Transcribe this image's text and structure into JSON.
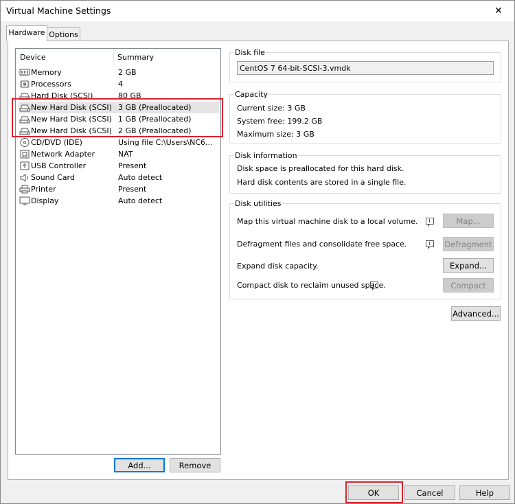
{
  "window": {
    "title": "Virtual Machine Settings",
    "close_glyph": "✕"
  },
  "tabs": [
    {
      "label": "Hardware"
    },
    {
      "label": "Options"
    }
  ],
  "device_list": {
    "headers": {
      "device": "Device",
      "summary": "Summary"
    },
    "items": [
      {
        "icon": "memory-icon",
        "device": "Memory",
        "summary": "2 GB"
      },
      {
        "icon": "processor-icon",
        "device": "Processors",
        "summary": "4"
      },
      {
        "icon": "hard-disk-icon",
        "device": "Hard Disk (SCSI)",
        "summary": "80 GB"
      },
      {
        "icon": "hard-disk-icon",
        "device": "New Hard Disk (SCSI)",
        "summary": "3 GB (Preallocated)"
      },
      {
        "icon": "hard-disk-icon",
        "device": "New Hard Disk (SCSI)",
        "summary": "1 GB (Preallocated)"
      },
      {
        "icon": "hard-disk-icon",
        "device": "New Hard Disk (SCSI)",
        "summary": "2 GB (Preallocated)"
      },
      {
        "icon": "cd-dvd-icon",
        "device": "CD/DVD (IDE)",
        "summary": "Using file C:\\Users\\NC6..."
      },
      {
        "icon": "network-adapter-icon",
        "device": "Network Adapter",
        "summary": "NAT"
      },
      {
        "icon": "usb-icon",
        "device": "USB Controller",
        "summary": "Present"
      },
      {
        "icon": "sound-card-icon",
        "device": "Sound Card",
        "summary": "Auto detect"
      },
      {
        "icon": "printer-icon",
        "device": "Printer",
        "summary": "Present"
      },
      {
        "icon": "display-icon",
        "device": "Display",
        "summary": "Auto detect"
      }
    ],
    "add_label": "Add...",
    "remove_label": "Remove"
  },
  "disk_file": {
    "label": "Disk file",
    "value": "CentOS 7 64-bit-SCSI-3.vmdk"
  },
  "capacity": {
    "label": "Capacity",
    "current_size": "Current size:  3 GB",
    "system_free": "System free:  199.2 GB",
    "maximum_size": "Maximum size:  3 GB"
  },
  "disk_information": {
    "label": "Disk information",
    "line1": "Disk space is preallocated for this hard disk.",
    "line2": "Hard disk contents are stored in a single file."
  },
  "disk_utilities": {
    "label": "Disk utilities",
    "map_text": "Map this virtual machine disk to a local volume.",
    "map_button": "Map...",
    "defrag_text": "Defragment files and consolidate free space.",
    "defrag_button": "Defragment",
    "expand_text": "Expand disk capacity.",
    "expand_button": "Expand...",
    "compact_text": "Compact disk to reclaim unused space.",
    "compact_button": "Compact"
  },
  "advanced_label": "Advanced...",
  "footer": {
    "ok": "OK",
    "cancel": "Cancel",
    "help": "Help"
  },
  "colors": {
    "highlight": "#d9232e",
    "selection": "#e5e5e5",
    "default_button_border": "#0078d7"
  }
}
